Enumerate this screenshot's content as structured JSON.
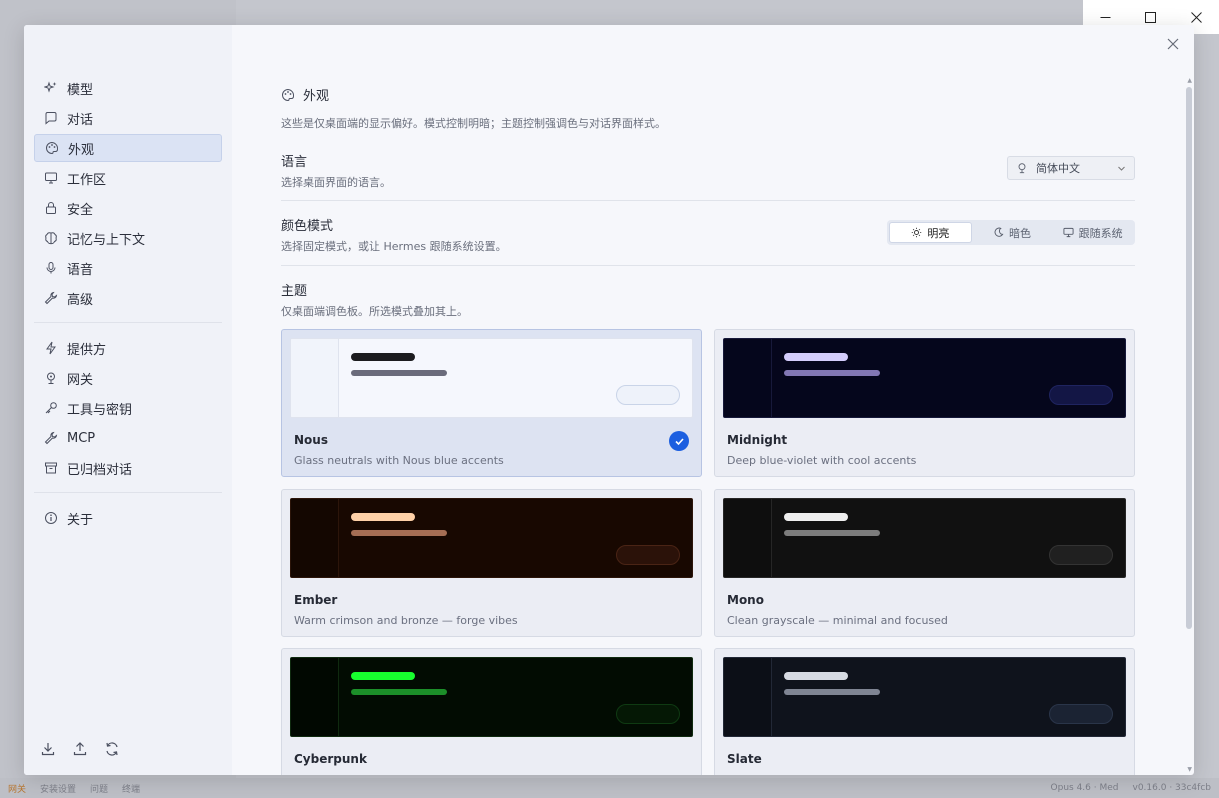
{
  "background_app": {
    "status_left": [
      "网关",
      "安装设置",
      "问题",
      "终端"
    ],
    "status_right": [
      "Opus 4.6 · Med",
      "v0.16.0 · 33c4fcb"
    ]
  },
  "sidebar": {
    "items": [
      {
        "label": "模型",
        "icon": "sparkles-icon"
      },
      {
        "label": "对话",
        "icon": "chat-bubble-icon"
      },
      {
        "label": "外观",
        "icon": "palette-icon"
      },
      {
        "label": "工作区",
        "icon": "monitor-icon"
      },
      {
        "label": "安全",
        "icon": "lock-icon"
      },
      {
        "label": "记忆与上下文",
        "icon": "brain-icon"
      },
      {
        "label": "语音",
        "icon": "microphone-icon"
      },
      {
        "label": "高级",
        "icon": "wrench-icon"
      }
    ],
    "items2": [
      {
        "label": "提供方",
        "icon": "bolt-icon"
      },
      {
        "label": "网关",
        "icon": "gateway-icon"
      },
      {
        "label": "工具与密钥",
        "icon": "key-icon"
      },
      {
        "label": "MCP",
        "icon": "wrench-icon"
      },
      {
        "label": "已归档对话",
        "icon": "archive-icon"
      }
    ],
    "items3": [
      {
        "label": "关于",
        "icon": "info-icon"
      }
    ],
    "active_index": 2
  },
  "content": {
    "section_title": "外观",
    "section_desc": "这些是仅桌面端的显示偏好。模式控制明暗；主题控制强调色与对话界面样式。",
    "language": {
      "label": "语言",
      "desc": "选择桌面界面的语言。",
      "value": "简体中文"
    },
    "color_mode": {
      "label": "颜色模式",
      "desc": "选择固定模式，或让 Hermes 跟随系统设置。",
      "options": [
        "明亮",
        "暗色",
        "跟随系统"
      ],
      "selected": "明亮"
    },
    "theme": {
      "label": "主题",
      "desc": "仅桌面端调色板。所选模式叠加其上。",
      "selected": "Nous",
      "cards": [
        {
          "name": "Nous",
          "desc": "Glass neutrals with Nous blue accents",
          "colors": {
            "bg": "#f5f7fd",
            "side": "#f1f4fb",
            "border": "#dfe3ee",
            "bar1": "#1c1c1f",
            "bar2": "#6a6b7b",
            "pill": "#eef2fa",
            "pill_border": "#c9d4e8"
          }
        },
        {
          "name": "Midnight",
          "desc": "Deep blue-violet with cool accents",
          "colors": {
            "bg": "#05061c",
            "side": "#05061c",
            "border": "#17193a",
            "bar1": "#d4cdfc",
            "bar2": "#8277b4",
            "pill": "#131645",
            "pill_border": "#1f2460"
          }
        },
        {
          "name": "Ember",
          "desc": "Warm crimson and bronze — forge vibes",
          "colors": {
            "bg": "#180801",
            "side": "#140701",
            "border": "#2c150a",
            "bar1": "#ffd1a8",
            "bar2": "#a66e54",
            "pill": "#2b1209",
            "pill_border": "#4a2415"
          }
        },
        {
          "name": "Mono",
          "desc": "Clean grayscale — minimal and focused",
          "colors": {
            "bg": "#111111",
            "side": "#0e0e0e",
            "border": "#262626",
            "bar1": "#efefef",
            "bar2": "#7d7d7d",
            "pill": "#202020",
            "pill_border": "#333333"
          }
        },
        {
          "name": "Cyberpunk",
          "desc": "",
          "colors": {
            "bg": "#020c02",
            "side": "#010801",
            "border": "#0f2a0f",
            "bar1": "#17ff2e",
            "bar2": "#1c8f29",
            "pill": "#051805",
            "pill_border": "#0f3a12"
          }
        },
        {
          "name": "Slate",
          "desc": "",
          "colors": {
            "bg": "#0f131c",
            "side": "#0c0f17",
            "border": "#222836",
            "bar1": "#d7dbe3",
            "bar2": "#7f8593",
            "pill": "#1b2333",
            "pill_border": "#2a3549"
          }
        }
      ]
    }
  }
}
